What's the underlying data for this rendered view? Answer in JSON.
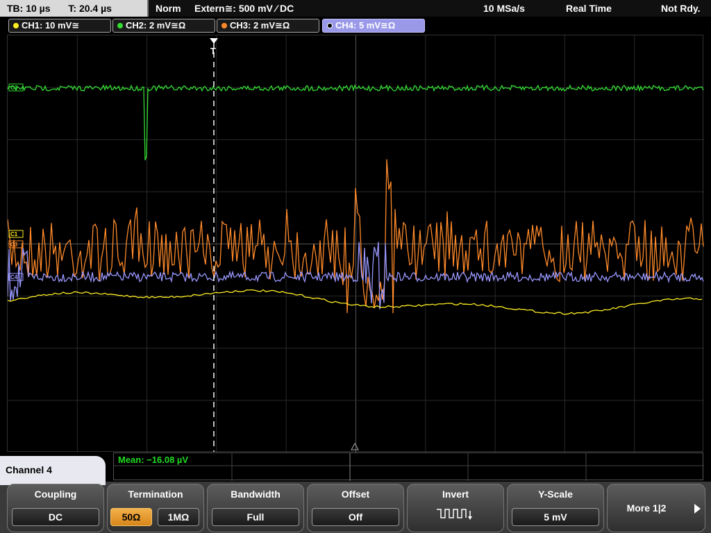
{
  "status_bar": {
    "timebase": "TB: 10 µs",
    "trigger_time": "T: 20.4 µs",
    "mode": "Norm",
    "trigger": "Extern≅: 500 mV ⁄ DC",
    "sample_rate": "10 MSa/s",
    "acq_mode": "Real Time",
    "state": "Not Rdy."
  },
  "channels": [
    {
      "label": "CH1: 10 mV≅",
      "color": "#ffee22"
    },
    {
      "label": "CH2: 2 mV≅Ω",
      "color": "#33dd33"
    },
    {
      "label": "CH3: 2 mV≅Ω",
      "color": "#ff8a2a"
    },
    {
      "label": "CH4: 5 mV≅Ω",
      "color": "#9a98ff"
    }
  ],
  "plot": {
    "trigger_marker": "T",
    "ch_markers": [
      "C2",
      "C1",
      "C3",
      "C4"
    ]
  },
  "measurement": {
    "label": "Mean: −16.08 µV"
  },
  "menu": {
    "title": "Channel 4",
    "softkeys": {
      "coupling": {
        "title": "Coupling",
        "value": "DC"
      },
      "termination": {
        "title": "Termination",
        "opt1": "50Ω",
        "opt2": "1MΩ"
      },
      "bandwidth": {
        "title": "Bandwidth",
        "value": "Full"
      },
      "offset": {
        "title": "Offset",
        "value": "Off"
      },
      "invert": {
        "title": "Invert"
      },
      "yscale": {
        "title": "Y-Scale",
        "value": "5 mV"
      },
      "more": {
        "label": "More 1|2"
      }
    }
  }
}
